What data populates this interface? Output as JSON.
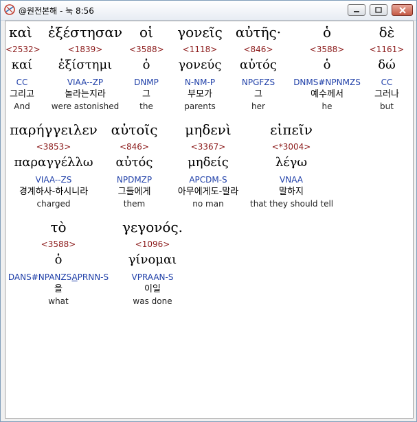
{
  "window": {
    "title": "@원전본해 - 눅 8:56",
    "buttons": {
      "minimize": "minimize-icon",
      "maximize": "maximize-icon",
      "close": "close-icon"
    }
  },
  "words": [
    {
      "greek": "καὶ",
      "strong": "<2532>",
      "lemma": "καί",
      "parse": "CC",
      "korean": "그리고",
      "english": "And"
    },
    {
      "greek": "ἐξέστησαν",
      "strong": "<1839>",
      "lemma": "ἐξίστημι",
      "parse": "VIAA--ZP",
      "korean": "놀라는지라",
      "english": "were astonished"
    },
    {
      "greek": "οἱ",
      "strong": "<3588>",
      "lemma": "ὁ",
      "parse": "DNMP",
      "korean": "그",
      "english": "the"
    },
    {
      "greek": "γονεῖς",
      "strong": "<1118>",
      "lemma": "γονεύς",
      "parse": "N-NM-P",
      "korean": "부모가",
      "english": "parents"
    },
    {
      "greek": "αὐτῆς·",
      "strong": "<846>",
      "lemma": "αὐτός",
      "parse": "NPGFZS",
      "korean": "그",
      "english": "her"
    },
    {
      "greek": "ὁ",
      "strong": "<3588>",
      "lemma": "ὁ",
      "parse": "DNMS#NPNMZS",
      "korean": "예수께서",
      "english": "he"
    },
    {
      "greek": "δὲ",
      "strong": "<1161>",
      "lemma": "δώ",
      "parse": "CC",
      "korean": "그러나",
      "english": "but"
    },
    {
      "greek": "παρήγγειλεν",
      "strong": "<3853>",
      "lemma": "παραγγέλλω",
      "parse": "VIAA--ZS",
      "korean": "경계하사-하시니라",
      "english": "charged"
    },
    {
      "greek": "αὐτοῖς",
      "strong": "<846>",
      "lemma": "αὐτός",
      "parse": "NPDMZP",
      "korean": "그들에게",
      "english": "them"
    },
    {
      "greek": "μηδενὶ",
      "strong": "<3367>",
      "lemma": "μηδείς",
      "parse": "APCDM-S",
      "korean": "아무에게도-말라",
      "english": "no man"
    },
    {
      "greek": "εἰπεῖν",
      "strong": "<*3004>",
      "lemma": "λέγω",
      "parse": "VNAA",
      "korean": "말하지",
      "english": "that they should tell"
    },
    {
      "greek": "τὸ",
      "strong": "<3588>",
      "lemma": "ὁ",
      "parse_prefix": "DANS#NPANZS",
      "parse_underlined": "A",
      "parse_suffix": "PRNN-S",
      "korean": "을",
      "english": "what"
    },
    {
      "greek": "γεγονός.",
      "strong": "<1096>",
      "lemma": "γίνομαι",
      "parse": "VPRAAN-S",
      "korean": "이일",
      "english": "was done"
    }
  ],
  "colors": {
    "strong": "#8b1a1a",
    "parse": "#1f3fa8",
    "title_bg": "#e7ecf3",
    "content_bg": "#ffffff",
    "close_button": "#c45a45"
  }
}
